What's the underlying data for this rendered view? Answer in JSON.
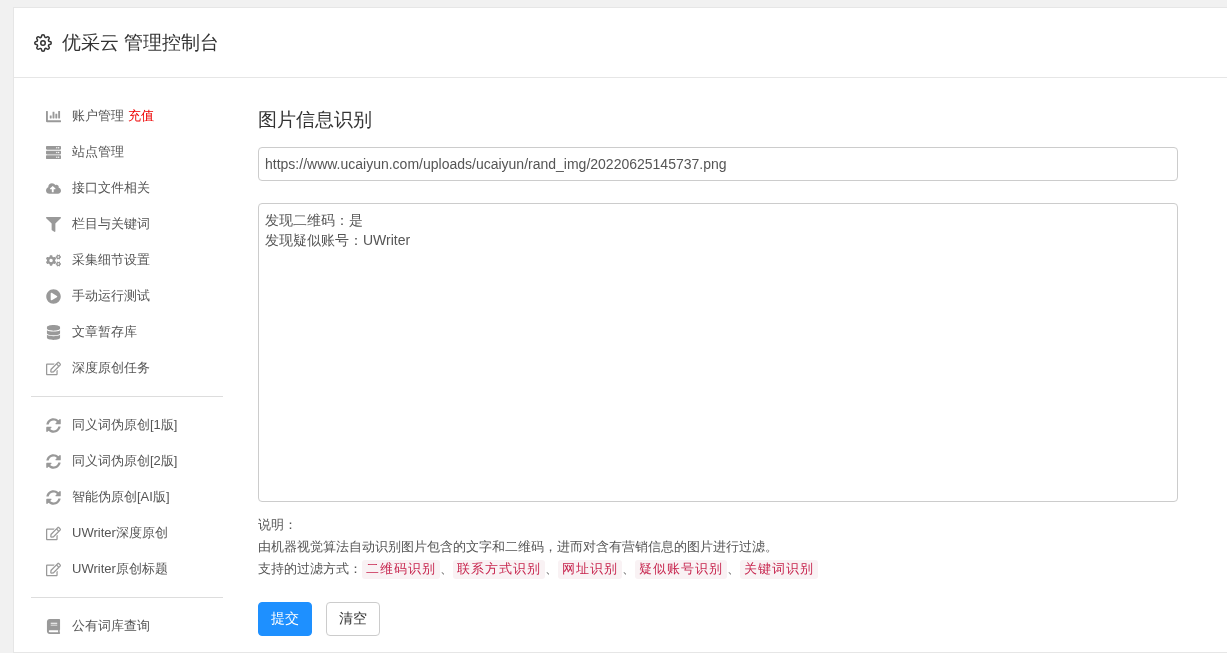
{
  "header": {
    "title": "优采云 管理控制台"
  },
  "sidebar": {
    "groups": [
      {
        "items": [
          {
            "label": "账户管理",
            "badge": "充值"
          },
          {
            "label": "站点管理"
          },
          {
            "label": "接口文件相关"
          },
          {
            "label": "栏目与关键词"
          },
          {
            "label": "采集细节设置"
          },
          {
            "label": "手动运行测试"
          },
          {
            "label": "文章暂存库"
          },
          {
            "label": "深度原创任务"
          }
        ]
      },
      {
        "items": [
          {
            "label": "同义词伪原创[1版]"
          },
          {
            "label": "同义词伪原创[2版]"
          },
          {
            "label": "智能伪原创[AI版]"
          },
          {
            "label": "UWriter深度原创"
          },
          {
            "label": "UWriter原创标题"
          }
        ]
      },
      {
        "items": [
          {
            "label": "公有词库查询"
          }
        ]
      }
    ]
  },
  "main": {
    "title": "图片信息识别",
    "url_field": {
      "value": "https://www.ucaiyun.com/uploads/ucaiyun/rand_img/20220625145737.png"
    },
    "result_box": {
      "lines": [
        "发现二维码：是",
        "发现疑似账号：UWriter"
      ]
    },
    "note_title": "说明：",
    "note_text": "由机器视觉算法自动识别图片包含的文字和二维码，进而对含有营销信息的图片进行过滤。",
    "methods_label": "支持的过滤方式：",
    "methods": [
      "二维码识别",
      "联系方式识别",
      "网址识别",
      "疑似账号识别",
      "关键词识别"
    ],
    "separator": "、",
    "buttons": [
      {
        "label": "提交",
        "kind": "primary"
      },
      {
        "label": "清空",
        "kind": "default"
      }
    ]
  }
}
